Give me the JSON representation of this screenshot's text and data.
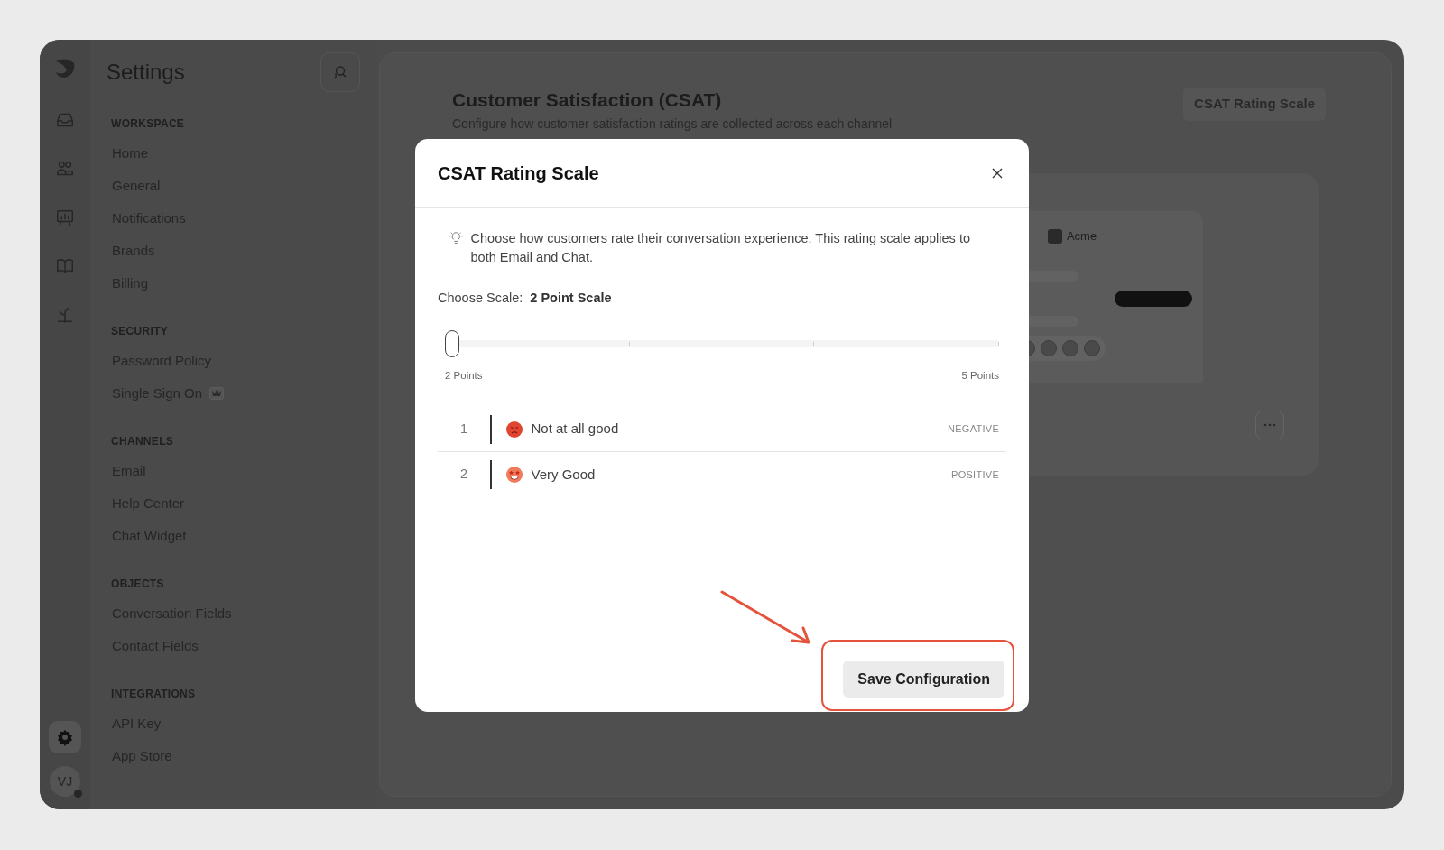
{
  "sidebar": {
    "title": "Settings",
    "sections": [
      {
        "heading": "WORKSPACE",
        "items": [
          {
            "label": "Home",
            "premium": false
          },
          {
            "label": "General",
            "premium": false
          },
          {
            "label": "Notifications",
            "premium": false
          },
          {
            "label": "Brands",
            "premium": false
          },
          {
            "label": "Billing",
            "premium": false
          }
        ]
      },
      {
        "heading": "SECURITY",
        "items": [
          {
            "label": "Password Policy",
            "premium": false
          },
          {
            "label": "Single Sign On",
            "premium": true
          }
        ]
      },
      {
        "heading": "CHANNELS",
        "items": [
          {
            "label": "Email",
            "premium": false
          },
          {
            "label": "Help Center",
            "premium": false
          },
          {
            "label": "Chat Widget",
            "premium": false
          }
        ]
      },
      {
        "heading": "OBJECTS",
        "items": [
          {
            "label": "Conversation Fields",
            "premium": false
          },
          {
            "label": "Contact Fields",
            "premium": false
          }
        ]
      },
      {
        "heading": "INTEGRATIONS",
        "items": [
          {
            "label": "API Key",
            "premium": false
          },
          {
            "label": "App Store",
            "premium": false
          }
        ]
      }
    ],
    "user": {
      "initials": "VJ",
      "online": true
    }
  },
  "page": {
    "title": "Customer Satisfaction (CSAT)",
    "subtitle": "Configure how customer satisfaction ratings are collected across each channel",
    "action": "CSAT Rating Scale",
    "preview": {
      "brand": "Acme"
    }
  },
  "modal": {
    "title": "CSAT Rating Scale",
    "hint": "Choose how customers rate their conversation experience. This rating scale applies to both Email and Chat.",
    "scale_label": "Choose Scale:",
    "scale_value": "2 Point Scale",
    "slider": {
      "level": 0,
      "min_label": "2 Points",
      "max_label": "5 Points"
    },
    "ratings": [
      {
        "number": "1",
        "label": "Not at all good",
        "sentiment": "NEGATIVE",
        "kind": "angry"
      },
      {
        "number": "2",
        "label": "Very Good",
        "sentiment": "POSITIVE",
        "kind": "starstruck"
      }
    ],
    "save": "Save Configuration"
  }
}
